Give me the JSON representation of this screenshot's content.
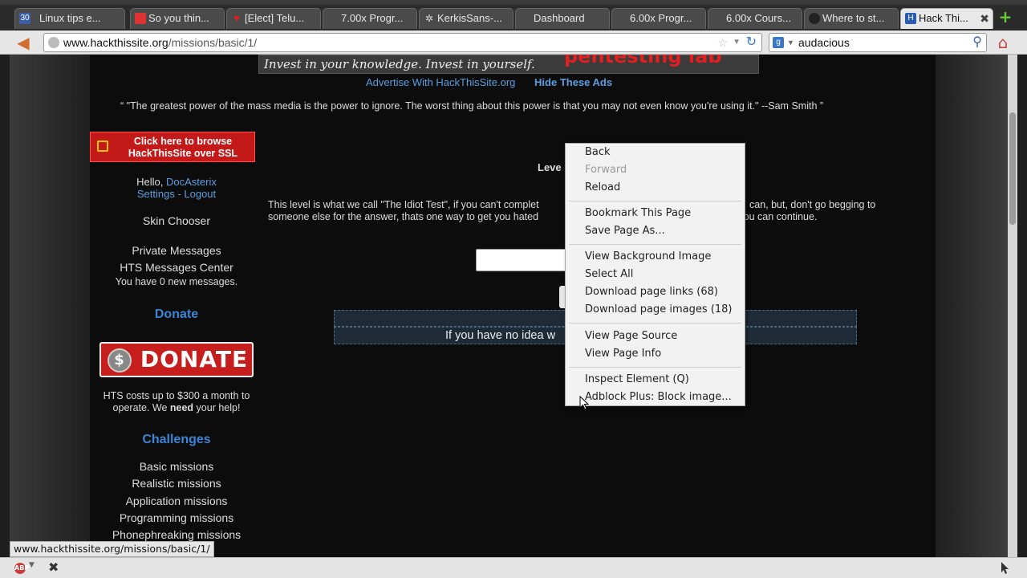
{
  "tabs": [
    {
      "label": "Linux tips e...",
      "icon": "tux-icon"
    },
    {
      "label": "So you thin...",
      "icon": "feed-icon"
    },
    {
      "label": "[Elect] Telu...",
      "icon": "heart-icon"
    },
    {
      "label": "7.00x Progr...",
      "icon": ""
    },
    {
      "label": "KerkisSans-...",
      "icon": "gear-icon"
    },
    {
      "label": "Dashboard",
      "icon": ""
    },
    {
      "label": "6.00x Progr...",
      "icon": ""
    },
    {
      "label": "6.00x Cours...",
      "icon": ""
    },
    {
      "label": "Where to st...",
      "icon": "globe-icon"
    },
    {
      "label": "Hack Thi...",
      "icon": "hts-icon"
    }
  ],
  "calendar_badge": "30",
  "nav": {
    "url_host": "www.hackthissite.org",
    "url_path": "/missions/basic/1/",
    "search_value": "audacious"
  },
  "ad": {
    "banner_text": "Invest in your knowledge. Invest in yourself.",
    "banner_red": "pentesting lab",
    "advertise_link": "Advertise With HackThisSite.org",
    "hide_link": "Hide These Ads"
  },
  "quote": "“ \"The greatest power of the mass media is the power to ignore. The worst thing about this power is that you may not even know you're using it.\" --Sam Smith ”",
  "sidebar": {
    "ssl_line1": "Click here to browse",
    "ssl_line2": "HackThisSite over SSL",
    "hello_prefix": "Hello, ",
    "username": "DocAsterix",
    "settings": "Settings",
    "separator": " - ",
    "logout": "Logout",
    "skin_chooser": "Skin Chooser",
    "private_messages": "Private Messages",
    "hts_messages": "HTS Messages Center",
    "new_messages": "You have 0 new messages.",
    "donate_title": "Donate",
    "donate_button": "DONATE",
    "donate_coin": "$",
    "cost_line1": "HTS costs up to $300 a month to",
    "cost_line2_pre": "operate. We ",
    "cost_line2_bold": "need",
    "cost_line2_post": " your help!",
    "challenges_title": "Challenges",
    "missions": [
      "Basic missions",
      "Realistic missions",
      "Application missions",
      "Programming missions",
      "Phonephreaking missions"
    ]
  },
  "main": {
    "level_title": "Leve",
    "level_desc_part1": "This level is what we call \"The Idiot Test\", if you can't complet",
    "level_desc_part1_tail": "can, but, don't go begging to",
    "level_desc_part2": "someone else for the answer, thats one way to get you hated",
    "level_desc_part2_tail": "d you can continue.",
    "hint_text": "If you have no idea w",
    "hint_tail": "."
  },
  "context_menu": {
    "items": [
      {
        "label": "Back",
        "enabled": true
      },
      {
        "label": "Forward",
        "enabled": false
      },
      {
        "label": "Reload",
        "enabled": true
      },
      {
        "label": "Bookmark This Page",
        "enabled": true
      },
      {
        "label": "Save Page As...",
        "enabled": true
      },
      {
        "label": "View Background Image",
        "enabled": true
      },
      {
        "label": "Select All",
        "enabled": true
      },
      {
        "label": "Download page links (68)",
        "enabled": true
      },
      {
        "label": "Download page images (18)",
        "enabled": true
      },
      {
        "label": "View Page Source",
        "enabled": true
      },
      {
        "label": "View Page Info",
        "enabled": true
      },
      {
        "label": "Inspect Element (Q)",
        "enabled": true
      },
      {
        "label": "Adblock Plus: Block image...",
        "enabled": true
      }
    ]
  },
  "status": {
    "hover_url": "www.hackthissite.org/missions/basic/1/"
  },
  "addon": {
    "abp_label": "ABP"
  },
  "colors": {
    "link_blue": "#5a9fe0",
    "accent_red": "#c41919",
    "page_bg": "#0c0c0c"
  }
}
